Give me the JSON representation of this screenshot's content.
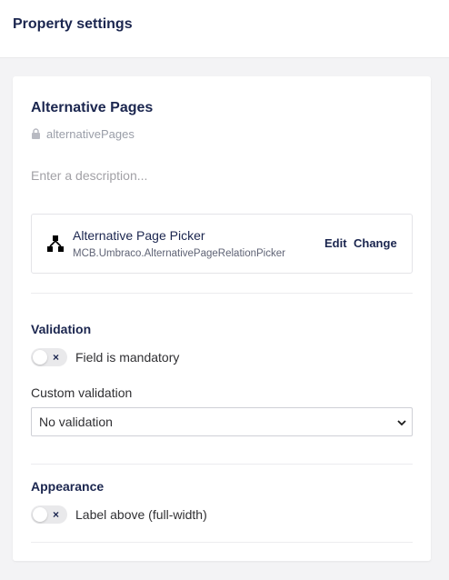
{
  "header": {
    "title": "Property settings"
  },
  "property": {
    "name": "Alternative Pages",
    "alias": "alternativePages",
    "description_placeholder": "Enter a description..."
  },
  "editor": {
    "icon": "tree-icon",
    "name": "Alternative Page Picker",
    "alias": "MCB.Umbraco.AlternativePageRelationPicker",
    "edit_label": "Edit",
    "change_label": "Change"
  },
  "validation": {
    "title": "Validation",
    "mandatory_label": "Field is mandatory",
    "mandatory_on": false,
    "custom_label": "Custom validation",
    "custom_value": "No validation"
  },
  "appearance": {
    "title": "Appearance",
    "label_above_label": "Label above (full-width)",
    "label_above_on": false
  },
  "colors": {
    "text_primary": "#1b264f",
    "background": "#f3f3f5",
    "toggle_off": "#e9e9eb"
  }
}
